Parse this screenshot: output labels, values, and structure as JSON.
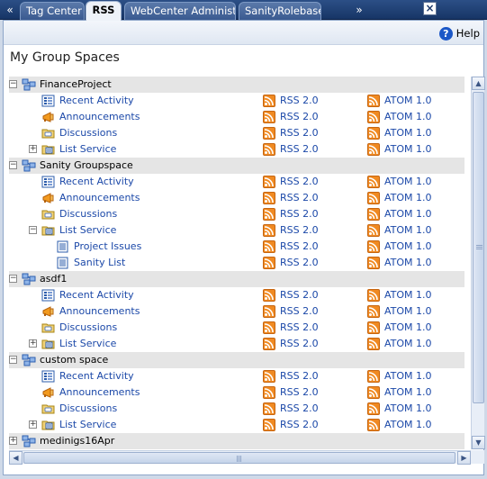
{
  "tabs": [
    {
      "label": "Tag Center",
      "active": false
    },
    {
      "label": "RSS",
      "active": true
    },
    {
      "label": "WebCenter Administ...",
      "active": false
    },
    {
      "label": "SanityRolebased",
      "active": false
    }
  ],
  "tab_nav": {
    "prev_icon": "double-chevron-left-icon",
    "next_icon": "double-chevron-right-icon",
    "close_icon": "close-icon"
  },
  "help": {
    "label": "Help",
    "icon": "help-icon"
  },
  "page_title": "My Group Spaces",
  "feeds": {
    "rss": "RSS 2.0",
    "atom": "ATOM 1.0",
    "icon": "rss-feed-icon"
  },
  "tree": [
    {
      "type": "group",
      "label": "FinanceProject",
      "expanded": true
    },
    {
      "type": "item",
      "label": "Recent Activity",
      "icon": "recent-activity-icon",
      "level": 1
    },
    {
      "type": "item",
      "label": "Announcements",
      "icon": "megaphone-icon",
      "level": 1
    },
    {
      "type": "item",
      "label": "Discussions",
      "icon": "discussion-folder-icon",
      "level": 1
    },
    {
      "type": "item",
      "label": "List Service",
      "icon": "list-service-icon",
      "level": 1,
      "expander": "+"
    },
    {
      "type": "group",
      "label": "Sanity Groupspace",
      "expanded": true
    },
    {
      "type": "item",
      "label": "Recent Activity",
      "icon": "recent-activity-icon",
      "level": 1
    },
    {
      "type": "item",
      "label": "Announcements",
      "icon": "megaphone-icon",
      "level": 1
    },
    {
      "type": "item",
      "label": "Discussions",
      "icon": "discussion-folder-icon",
      "level": 1
    },
    {
      "type": "item",
      "label": "List Service",
      "icon": "list-service-icon",
      "level": 1,
      "expander": "-"
    },
    {
      "type": "item",
      "label": "Project Issues",
      "icon": "list-doc-icon",
      "level": 2
    },
    {
      "type": "item",
      "label": "Sanity List",
      "icon": "list-doc-icon",
      "level": 2
    },
    {
      "type": "group",
      "label": "asdf1",
      "expanded": true
    },
    {
      "type": "item",
      "label": "Recent Activity",
      "icon": "recent-activity-icon",
      "level": 1
    },
    {
      "type": "item",
      "label": "Announcements",
      "icon": "megaphone-icon",
      "level": 1
    },
    {
      "type": "item",
      "label": "Discussions",
      "icon": "discussion-folder-icon",
      "level": 1
    },
    {
      "type": "item",
      "label": "List Service",
      "icon": "list-service-icon",
      "level": 1,
      "expander": "+"
    },
    {
      "type": "group",
      "label": "custom space",
      "expanded": true
    },
    {
      "type": "item",
      "label": "Recent Activity",
      "icon": "recent-activity-icon",
      "level": 1
    },
    {
      "type": "item",
      "label": "Announcements",
      "icon": "megaphone-icon",
      "level": 1
    },
    {
      "type": "item",
      "label": "Discussions",
      "icon": "discussion-folder-icon",
      "level": 1
    },
    {
      "type": "item",
      "label": "List Service",
      "icon": "list-service-icon",
      "level": 1,
      "expander": "+"
    },
    {
      "type": "group",
      "label": "medinigs16Apr",
      "expanded": false
    }
  ],
  "colors": {
    "link": "#1b48a8",
    "group_row": "#e5e5e5",
    "tab_bar": "#173566",
    "feed_orange": "#f08a22"
  }
}
